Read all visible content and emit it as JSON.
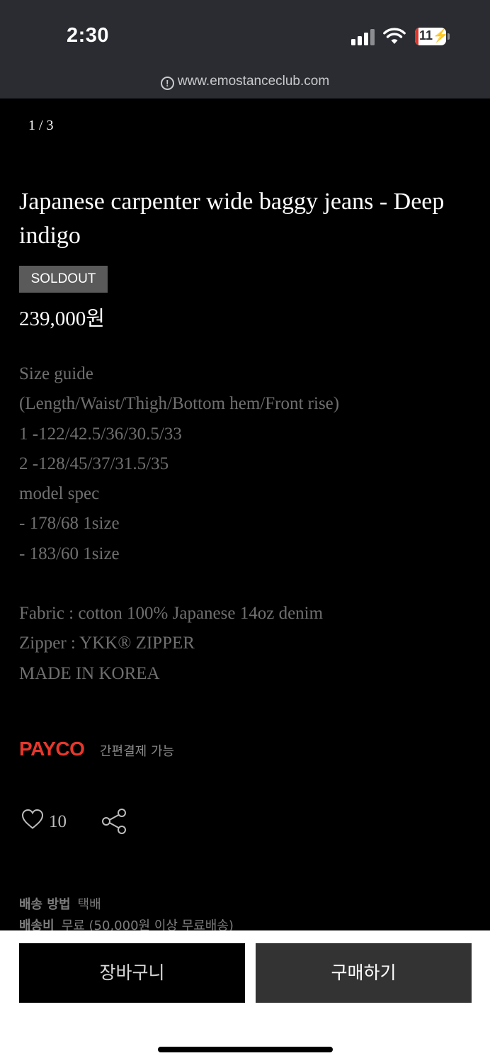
{
  "status_bar": {
    "time": "2:30",
    "battery": "11"
  },
  "browser": {
    "url": "www.emostanceclub.com"
  },
  "gallery": {
    "counter": "1 / 3"
  },
  "product": {
    "title": "Japanese carpenter wide baggy jeans - Deep indigo",
    "badge": "SOLDOUT",
    "price": "239,000원"
  },
  "description": {
    "lines": [
      "Size guide",
      "(Length/Waist/Thigh/Bottom hem/Front rise)",
      "1 -122/42.5/36/30.5/33",
      "2 -128/45/37/31.5/35",
      "model spec",
      "- 178/68 1size",
      "- 183/60 1size",
      "",
      "Fabric : cotton 100% Japanese 14oz denim",
      "Zipper : YKK® ZIPPER",
      "MADE IN KOREA"
    ]
  },
  "payment": {
    "logo": "PAYCO",
    "note": "간편결제 가능"
  },
  "social": {
    "like_count": "10"
  },
  "shipping": {
    "method_label": "배송 방법",
    "method_value": "택배",
    "fee_label": "배송비",
    "fee_value": "무료 (50,000원 이상 무료배송)"
  },
  "buttons": {
    "cart": "장바구니",
    "buy": "구매하기"
  }
}
